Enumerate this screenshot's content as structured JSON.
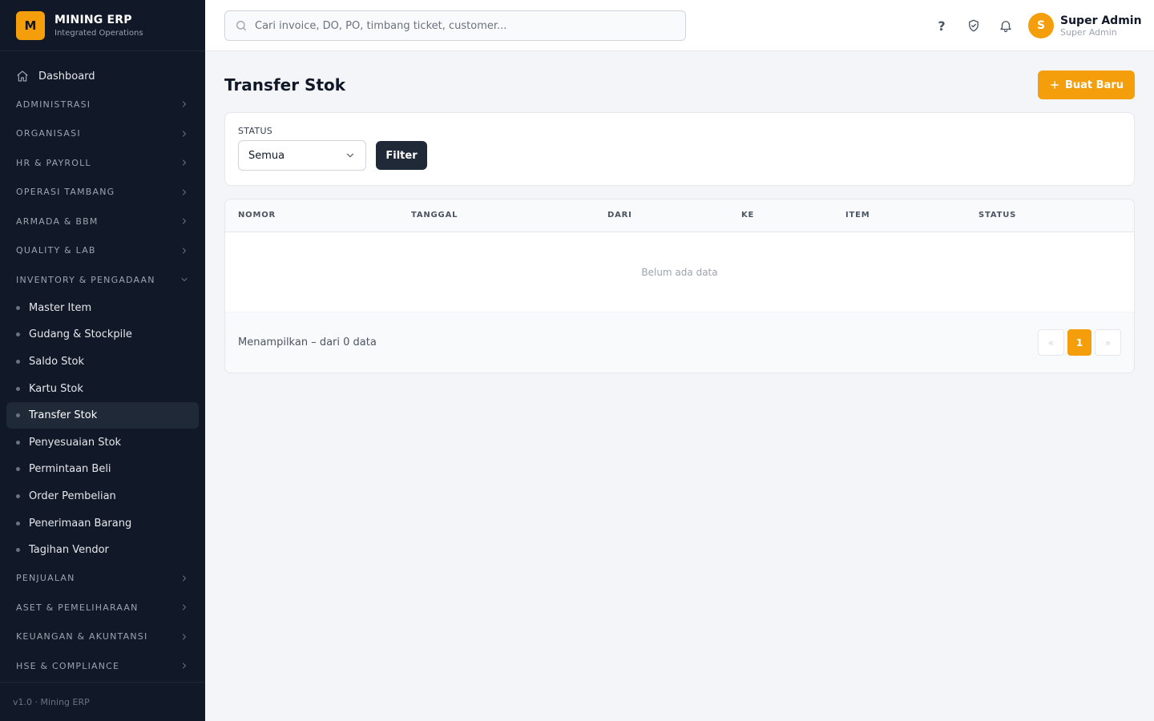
{
  "brand": {
    "logo_letter": "M",
    "name": "MINING ERP",
    "subtitle": "Integrated Operations",
    "color": "#f59e0b"
  },
  "sidebar": {
    "dashboard": "Dashboard",
    "groups": [
      {
        "label": "ADMINISTRASI",
        "expanded": false
      },
      {
        "label": "ORGANISASI",
        "expanded": false
      },
      {
        "label": "HR & PAYROLL",
        "expanded": false
      },
      {
        "label": "OPERASI TAMBANG",
        "expanded": false
      },
      {
        "label": "ARMADA & BBM",
        "expanded": false
      },
      {
        "label": "QUALITY & LAB",
        "expanded": false
      },
      {
        "label": "INVENTORY & PENGADAAN",
        "expanded": true
      },
      {
        "label": "PENJUALAN",
        "expanded": false
      },
      {
        "label": "ASET & PEMELIHARAAN",
        "expanded": false
      },
      {
        "label": "KEUANGAN & AKUNTANSI",
        "expanded": false
      },
      {
        "label": "HSE & COMPLIANCE",
        "expanded": false
      }
    ],
    "inventory_items": [
      "Master Item",
      "Gudang & Stockpile",
      "Saldo Stok",
      "Kartu Stok",
      "Transfer Stok",
      "Penyesuaian Stok",
      "Permintaan Beli",
      "Order Pembelian",
      "Penerimaan Barang",
      "Tagihan Vendor"
    ],
    "active_item": "Transfer Stok",
    "version": "v1.0 · Mining ERP"
  },
  "search": {
    "placeholder": "Cari invoice, DO, PO, timbang ticket, customer..."
  },
  "topbar": {
    "help_icon": "question-icon",
    "icons": [
      "question-icon",
      "shield-check-icon",
      "bell-icon"
    ]
  },
  "user": {
    "initial": "S",
    "name": "Super Admin",
    "role": "Super Admin"
  },
  "page": {
    "title": "Transfer Stok",
    "new_button": "Buat Baru"
  },
  "filter": {
    "label": "STATUS",
    "selected": "Semua",
    "button": "Filter"
  },
  "table": {
    "columns": [
      "NOMOR",
      "TANGGAL",
      "DARI",
      "KE",
      "ITEM",
      "STATUS"
    ],
    "rows": [],
    "empty_text": "Belum ada data"
  },
  "pagination": {
    "summary": "Menampilkan – dari 0 data",
    "prev": "«",
    "current": "1",
    "next": "»"
  }
}
